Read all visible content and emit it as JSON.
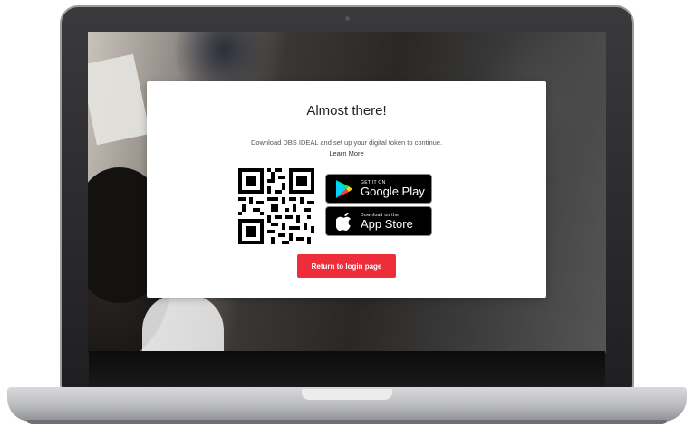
{
  "modal": {
    "title": "Almost there!",
    "description": "Download DBS IDEAL and set up your digital token to continue.",
    "learn_more": "Learn More",
    "return_button": "Return to login page"
  },
  "stores": {
    "google_play": {
      "small": "GET IT ON",
      "big": "Google Play",
      "icon": "google-play-icon"
    },
    "app_store": {
      "small": "Download on the",
      "big": "App Store",
      "icon": "apple-icon"
    }
  },
  "colors": {
    "accent": "#ee2d3a",
    "card": "#ffffff",
    "store_button": "#000000"
  }
}
